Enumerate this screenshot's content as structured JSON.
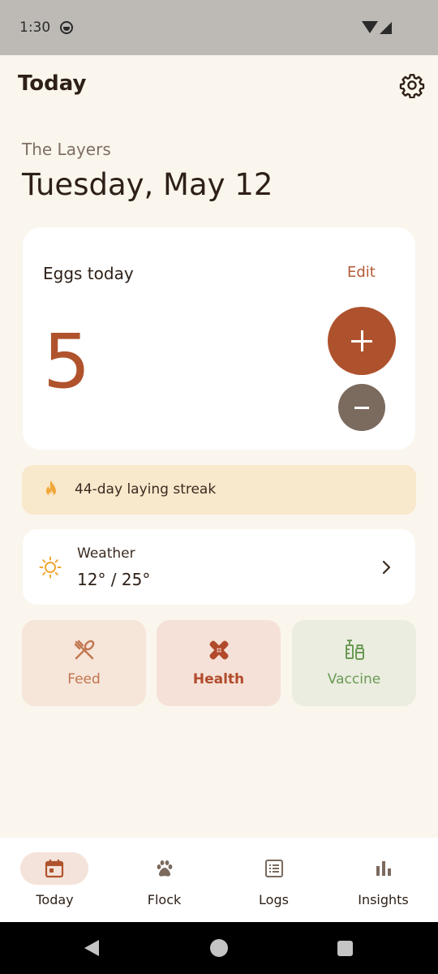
{
  "status_bar": {
    "time": "1:30"
  },
  "header": {
    "title": "Today",
    "settings_icon": "gear-icon"
  },
  "flock": {
    "name": "The Layers"
  },
  "date": "Tuesday, May 12",
  "eggs": {
    "label": "Eggs today",
    "edit_label": "Edit",
    "count": "5",
    "increment_icon": "plus-icon",
    "decrement_icon": "minus-icon"
  },
  "streak": {
    "text": "44-day laying streak",
    "icon": "flame-icon"
  },
  "weather": {
    "label": "Weather",
    "temp": "12° / 25°",
    "icon": "sun-icon"
  },
  "quick_actions": [
    {
      "label": "Feed",
      "icon": "utensils-icon"
    },
    {
      "label": "Health",
      "icon": "bandage-icon"
    },
    {
      "label": "Vaccine",
      "icon": "syringe-icon"
    }
  ],
  "bottom_nav": [
    {
      "label": "Today",
      "icon": "calendar-icon",
      "active": true
    },
    {
      "label": "Flock",
      "icon": "paw-icon"
    },
    {
      "label": "Logs",
      "icon": "list-icon"
    },
    {
      "label": "Insights",
      "icon": "bar-chart-icon"
    }
  ],
  "colors": {
    "accent": "#ae522d",
    "background": "#faf6ee",
    "streak_bg": "#f8e8cc",
    "vaccine_green": "#6c9a55"
  }
}
